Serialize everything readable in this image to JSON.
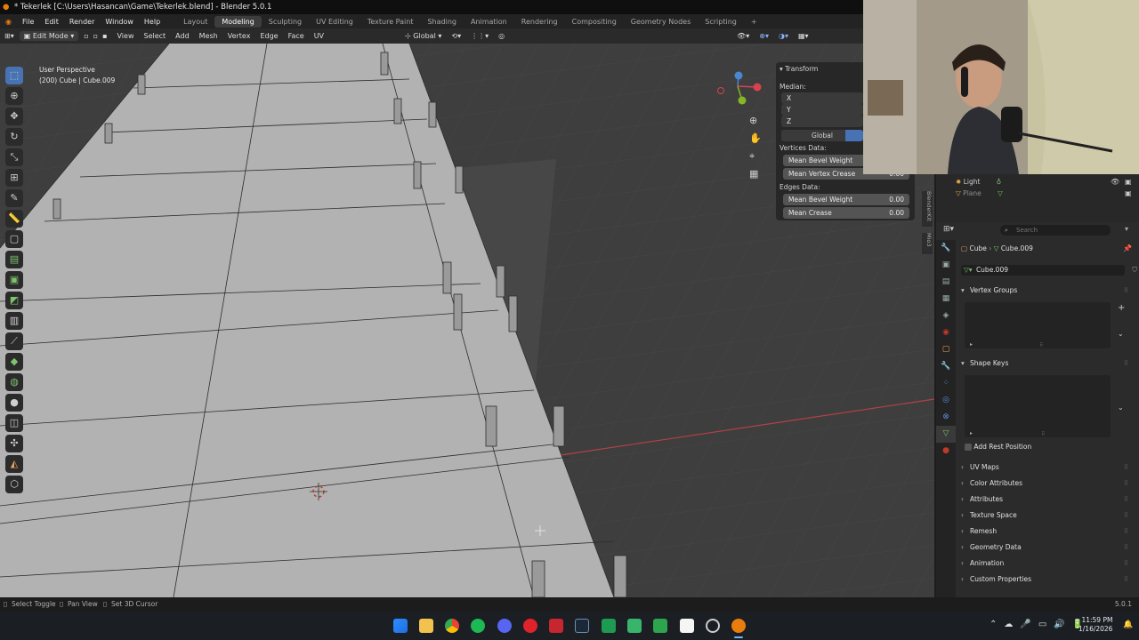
{
  "title_bar": {
    "text": "* Tekerlek [C:\\Users\\Hasancan\\Game\\Tekerlek.blend] - Blender 5.0.1"
  },
  "menu": {
    "items": [
      "File",
      "Edit",
      "Render",
      "Window",
      "Help"
    ]
  },
  "workspaces": {
    "tabs": [
      "Layout",
      "Modeling",
      "Sculpting",
      "UV Editing",
      "Texture Paint",
      "Shading",
      "Animation",
      "Rendering",
      "Compositing",
      "Geometry Nodes",
      "Scripting"
    ],
    "active": "Modeling",
    "add": "+"
  },
  "header": {
    "mode": "Edit Mode",
    "menus": [
      "View",
      "Select",
      "Add",
      "Mesh",
      "Vertex",
      "Edge",
      "Face",
      "UV"
    ],
    "orientation": "Global"
  },
  "viewport": {
    "perspective": "User Perspective",
    "object_info": "(200) Cube | Cube.009",
    "gizmo": {
      "x": "X",
      "y": "Y",
      "z": "Z"
    },
    "xray_axis": "Y"
  },
  "n_panel": {
    "title": "Transform",
    "median_label": "Median:",
    "x_label": "X",
    "y_label": "Y",
    "z_label": "Z",
    "space": "Global",
    "vertices_data": "Vertices Data:",
    "mean_bevel_weight_v": "Mean Bevel Weight",
    "mean_vertex_crease": "Mean Vertex Crease",
    "mean_vertex_crease_value": "0.00",
    "edges_data": "Edges Data:",
    "mean_bevel_weight_e": "Mean Bevel Weight",
    "mean_bevel_weight_e_value": "0.00",
    "mean_crease": "Mean Crease",
    "mean_crease_value": "0.00"
  },
  "side_tabs": [
    "BlenderKit",
    "Mio3"
  ],
  "outliner": {
    "items": [
      "Light",
      "Plane"
    ]
  },
  "properties": {
    "search_placeholder": "Search",
    "breadcrumb_object": "Cube",
    "breadcrumb_data": "Cube.009",
    "datablock_name": "Cube.009",
    "sections": [
      "Vertex Groups",
      "Shape Keys",
      "UV Maps",
      "Color Attributes",
      "Attributes",
      "Texture Space",
      "Remesh",
      "Geometry Data",
      "Animation",
      "Custom Properties"
    ],
    "add_rest_position": "Add Rest Position"
  },
  "status_bar": {
    "select_toggle": "Select Toggle",
    "pan_view": "Pan View",
    "set_3d_cursor": "Set 3D Cursor",
    "version": "5.0.1"
  },
  "taskbar": {
    "time": "11:59 PM",
    "date": "1/16/2026"
  },
  "colors": {
    "accent": "#4772b3",
    "axis_x": "#d8424f",
    "axis_y": "#86b525",
    "axis_z": "#4b86d6",
    "mesh_face": "#b2b2b2",
    "viewport_bg": "#3e3e3e"
  }
}
